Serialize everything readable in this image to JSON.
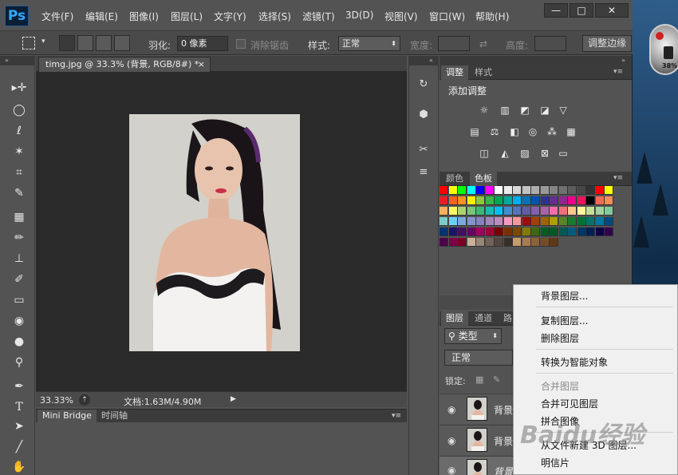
{
  "app": {
    "logo": "Ps",
    "menus": [
      "文件(F)",
      "编辑(E)",
      "图像(I)",
      "图层(L)",
      "文字(Y)",
      "选择(S)",
      "滤镜(T)",
      "3D(D)",
      "视图(V)",
      "窗口(W)",
      "帮助(H)"
    ],
    "window_buttons": [
      "—",
      "□",
      "✕"
    ]
  },
  "options": {
    "feather_label": "羽化:",
    "feather_value": "0 像素",
    "antialias_label": "消除锯齿",
    "style_label": "样式:",
    "style_value": "正常",
    "width_label": "宽度:",
    "height_label": "高度:",
    "refine_edge_button": "调整边缘"
  },
  "document": {
    "tab_title": "timg.jpg @ 33.3% (背景, RGB/8#) *",
    "tab_close": "×",
    "zoom": "33.33%",
    "doc_size": "文档:1.63M/4.90M"
  },
  "bottom_panel": {
    "tabs": [
      "Mini Bridge",
      "时间轴"
    ]
  },
  "adjustments_panel": {
    "tabs": [
      "调整",
      "样式"
    ],
    "title": "添加调整"
  },
  "swatches_panel": {
    "tabs": [
      "颜色",
      "色板"
    ],
    "colors": [
      "#ff0000",
      "#ffff00",
      "#00ff00",
      "#00ffff",
      "#0000ff",
      "#ff00ff",
      "#ffffff",
      "#ebebeb",
      "#d6d6d6",
      "#c2c2c2",
      "#adadad",
      "#999999",
      "#858585",
      "#707070",
      "#5c5c5c",
      "#474747",
      "#333333",
      "#ff0000",
      "#ffff00",
      "#ed1c24",
      "#f26522",
      "#f7941d",
      "#fff200",
      "#8dc63f",
      "#39b54a",
      "#00a651",
      "#00a99d",
      "#00aeef",
      "#0072bc",
      "#0054a6",
      "#2e3192",
      "#662d91",
      "#92278f",
      "#ec008c",
      "#ed145b",
      "#000000",
      "#f26c4f",
      "#f68e56",
      "#fbaf5d",
      "#fff568",
      "#acd373",
      "#7cc576",
      "#3bb878",
      "#1abbb4",
      "#00bff3",
      "#448ccb",
      "#5574b9",
      "#605ca8",
      "#8560a8",
      "#a864a8",
      "#f06eaa",
      "#f26d7d",
      "#fdc689",
      "#fff799",
      "#c4df9b",
      "#a3d39c",
      "#82ca9c",
      "#7accc8",
      "#6dcff6",
      "#7da7d9",
      "#8393ca",
      "#8781bd",
      "#a186be",
      "#bd8cbf",
      "#f49ac1",
      "#f5989d",
      "#9e0b0f",
      "#a0410d",
      "#a3620a",
      "#aba000",
      "#598527",
      "#197b30",
      "#007236",
      "#00746b",
      "#0076a3",
      "#004a80",
      "#003471",
      "#1b1464",
      "#440e62",
      "#630460",
      "#9e005d",
      "#9e0039",
      "#790000",
      "#7b2e00",
      "#7d4900",
      "#827b00",
      "#406618",
      "#005e20",
      "#005826",
      "#005952",
      "#005b7f",
      "#003663",
      "#002157",
      "#0d004c",
      "#32004b",
      "#4b0049",
      "#7b0046",
      "#7a0026",
      "#c7b299",
      "#998675",
      "#736357",
      "#534741",
      "#37302a",
      "#c69c6d",
      "#a67c52",
      "#8c6239",
      "#754c24",
      "#603913"
    ]
  },
  "layers_panel": {
    "tabs": [
      "图层",
      "通道",
      "路"
    ],
    "filter_label": "类型",
    "blend_mode": "正常",
    "lock_label": "锁定:",
    "layers": [
      {
        "name": "背景"
      },
      {
        "name": "背景"
      },
      {
        "name": "背景"
      }
    ]
  },
  "context_menu": {
    "items": [
      {
        "label": "背景图层...",
        "enabled": true
      },
      {
        "label": "复制图层...",
        "enabled": true
      },
      {
        "label": "删除图层",
        "enabled": true
      },
      {
        "label": "转换为智能对象",
        "enabled": true
      },
      {
        "label": "合并图层",
        "enabled": false
      },
      {
        "label": "合并可见图层",
        "enabled": true
      },
      {
        "label": "拼合图像",
        "enabled": true
      },
      {
        "label": "从文件新建 3D 图层...",
        "enabled": true
      },
      {
        "label": "明信片",
        "enabled": true
      }
    ]
  },
  "desktop": {
    "gauge_value": "38%"
  },
  "watermark": "Baidu经验"
}
